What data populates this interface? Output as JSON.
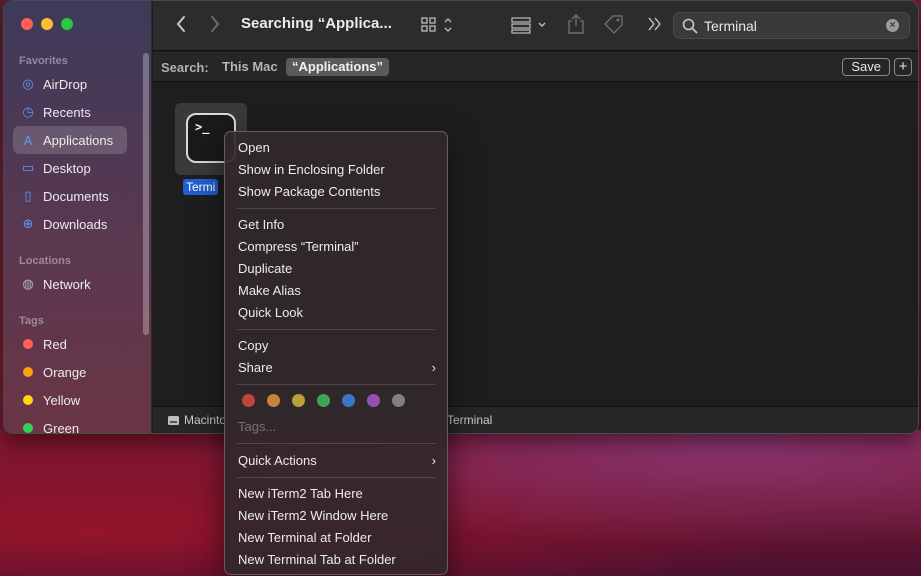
{
  "finder": {
    "sidebar": {
      "favorites_title": "Favorites",
      "favorites": [
        {
          "label": "AirDrop",
          "icon": "airdrop-icon",
          "glyph": "◎"
        },
        {
          "label": "Recents",
          "icon": "clock-icon",
          "glyph": "◷"
        },
        {
          "label": "Applications",
          "icon": "applications-icon",
          "glyph": "A"
        },
        {
          "label": "Desktop",
          "icon": "desktop-icon",
          "glyph": "▭"
        },
        {
          "label": "Documents",
          "icon": "document-icon",
          "glyph": "▯"
        },
        {
          "label": "Downloads",
          "icon": "download-icon",
          "glyph": "⊕"
        }
      ],
      "locations_title": "Locations",
      "locations": [
        {
          "label": "Network",
          "icon": "globe-icon",
          "glyph": "◍"
        }
      ],
      "tags_title": "Tags",
      "tags": [
        {
          "label": "Red",
          "color": "#ff5e57"
        },
        {
          "label": "Orange",
          "color": "#ff9f0a"
        },
        {
          "label": "Yellow",
          "color": "#ffd60a"
        },
        {
          "label": "Green",
          "color": "#30d158"
        }
      ]
    },
    "toolbar": {
      "title": "Searching “Applica...",
      "search_value": "Terminal"
    },
    "scope": {
      "label": "Search:",
      "this_mac": "This Mac",
      "applications": "“Applications”",
      "save": "Save",
      "add": "+"
    },
    "file": {
      "name": "Termi",
      "prompt": ">_"
    },
    "pathbar": {
      "first": "Macinto",
      "last": "Terminal"
    }
  },
  "context_menu": {
    "group1": [
      "Open",
      "Show in Enclosing Folder",
      "Show Package Contents"
    ],
    "group2": [
      "Get Info",
      "Compress “Terminal”",
      "Duplicate",
      "Make Alias",
      "Quick Look"
    ],
    "copy": "Copy",
    "share": "Share",
    "tag_colors": [
      "#c0453f",
      "#c5823a",
      "#b8a03a",
      "#3fa552",
      "#3a78c5",
      "#9350b0",
      "#808080"
    ],
    "tags_placeholder": "Tags...",
    "quick_actions": "Quick Actions",
    "services": [
      "New iTerm2 Tab Here",
      "New iTerm2 Window Here",
      "New Terminal at Folder",
      "New Terminal Tab at Folder"
    ]
  }
}
